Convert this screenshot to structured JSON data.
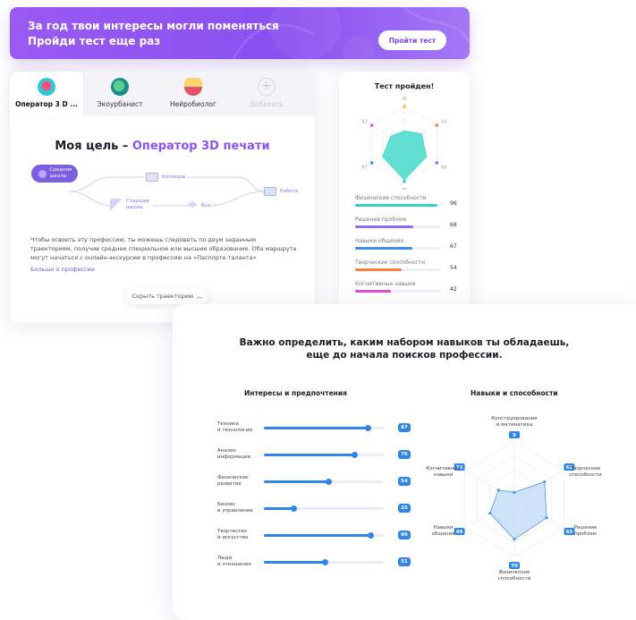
{
  "banner": {
    "line1": "За год твои интересы могли поменяться",
    "line2": "Пройди тест еще раз",
    "button": "Пройти тест"
  },
  "tabs": [
    {
      "label": "Оператор 3 D ...",
      "active": true,
      "icon": "flower-icon",
      "color": "#ff4d7a"
    },
    {
      "label": "Экоурбанист",
      "active": false,
      "icon": "globe-icon",
      "color": "#2ec27e"
    },
    {
      "label": "Нейробиолог",
      "active": false,
      "icon": "flask-icon",
      "color": "#f2b531"
    },
    {
      "label": "Добавить",
      "active": false,
      "icon": "plus-icon",
      "color": "#d9d9df"
    }
  ],
  "goal": {
    "prefix": "Моя цель –",
    "profession": "Оператор 3D печати"
  },
  "trajectory": {
    "start": "Средняя школа",
    "college": "Колледж",
    "senior": "Старшая школа",
    "university": "Вуз",
    "work": "Работа"
  },
  "description": "Чтобы освоить эту профессию, ты можешь следовать по двум заданным траекториям, получив среднее специальное или высшее образование. Оба маршрута могут начаться с онлайн-экскурсии в профессию на «Паспорте таланта»",
  "more_link": "Больше о профессии",
  "hide_button": "Скрыть траекторию",
  "test": {
    "title": "Тест пройден!",
    "radar_values": [
      35,
      54,
      68,
      96,
      67,
      42
    ],
    "skills": [
      {
        "label": "Физические способности",
        "value": 96,
        "color": "#2fd2c2"
      },
      {
        "label": "Решение проблем",
        "value": 68,
        "color": "#8b6cf2"
      },
      {
        "label": "Навыки общения",
        "value": 67,
        "color": "#3a8ef0"
      },
      {
        "label": "Творческие способности",
        "value": 54,
        "color": "#ff7a3d"
      },
      {
        "label": "Когнитивные навыки",
        "value": 42,
        "color": "#e24bd0"
      }
    ]
  },
  "bottom": {
    "headline_line1": "Важно определить, каким набором навыков ты обладаешь,",
    "headline_line2": "еще до начала поисков профессии.",
    "interests_title": "Интересы и предпочтения",
    "skills_title": "Навыки и способности",
    "interests": [
      {
        "label_line1": "Техника",
        "label_line2": "и технологии",
        "value": 87
      },
      {
        "label_line1": "Анализ",
        "label_line2": "информации",
        "value": 76
      },
      {
        "label_line1": "Физическое",
        "label_line2": "развитие",
        "value": 54
      },
      {
        "label_line1": "Бизнес",
        "label_line2": "и управление",
        "value": 25
      },
      {
        "label_line1": "Творчество",
        "label_line2": "и искусство",
        "value": 89
      },
      {
        "label_line1": "Люди",
        "label_line2": "и отношения",
        "value": 51
      }
    ],
    "radar": [
      {
        "label_line1": "Конструирование",
        "label_line2": "и математика",
        "value": 9
      },
      {
        "label_line1": "Творческие",
        "label_line2": "способности",
        "value": 61
      },
      {
        "label_line1": "Решение",
        "label_line2": "проблем",
        "value": 65
      },
      {
        "label_line1": "Физические",
        "label_line2": "способности",
        "value": 70
      },
      {
        "label_line1": "Навыки",
        "label_line2": "общения",
        "value": 49
      },
      {
        "label_line1": "Когнитивные",
        "label_line2": "навыки",
        "value": 32
      }
    ]
  }
}
